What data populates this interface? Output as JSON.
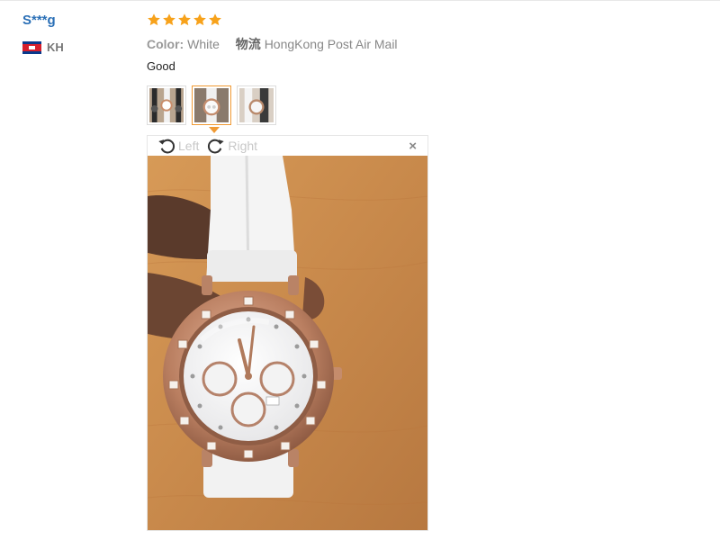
{
  "reviewer": {
    "name": "S***g",
    "country": "KH"
  },
  "rating": {
    "stars": 5,
    "max": 5
  },
  "meta": {
    "color_label": "Color:",
    "color_value": "White",
    "logistics_label": "物流",
    "logistics_value": "HongKong Post Air Mail"
  },
  "review": {
    "text": "Good"
  },
  "gallery": {
    "thumb_count": 3,
    "active_index": 1
  },
  "viewer": {
    "rotate_left": "Left",
    "rotate_right": "Right",
    "close": "×"
  },
  "colors": {
    "star": "#f7a21b",
    "accent": "#f09a34",
    "name": "#2a6fb6"
  }
}
